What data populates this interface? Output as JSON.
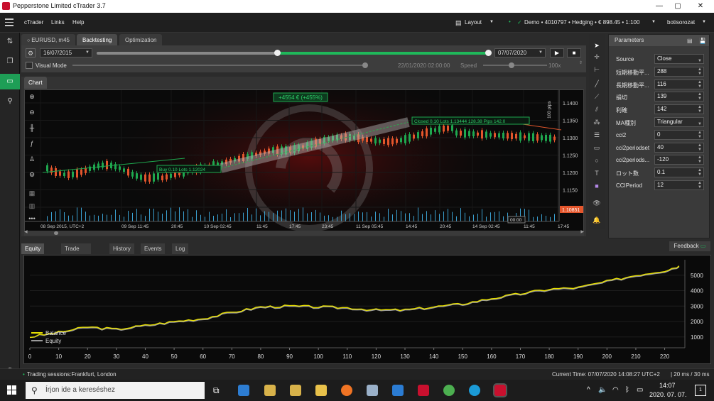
{
  "window": {
    "title": "Pepperstone Limited cTrader 3.7",
    "minimize": "—",
    "maximize": "▢",
    "close": "✕"
  },
  "menu": {
    "items": [
      "cTrader",
      "Links",
      "Help"
    ],
    "layout_label": "Layout",
    "account": "Demo • 4010797 • Hedging • € 898.45 • 1:100",
    "user": "botisorozat"
  },
  "tabs": {
    "symbol_tab": "EURUSD, m45",
    "backtesting": "Backtesting",
    "optimization": "Optimization"
  },
  "backtest": {
    "start_date": "16/07/2015",
    "end_date": "07/07/2020",
    "visual_mode": "Visual Mode",
    "progress_timestamp": "22/01/2020 02:00:00",
    "speed_label": "Speed",
    "speed_value": "100x",
    "range_start_fraction": 0.46,
    "progress_fraction": 1.0
  },
  "chart": {
    "tab_label": "Chart",
    "profit_badge": "+4554 € (+455%)",
    "buy_label": "Buy  0.10 Lots  1.12024",
    "closed_label": "Closed  0.10 Lots  1.13444  128.38  Pips 142.0",
    "pips_label": "100 pips",
    "current_price": "1.10851",
    "price_ticks": [
      "1.1400",
      "1.1350",
      "1.1300",
      "1.1250",
      "1.1200",
      "1.1150",
      "1.1100"
    ],
    "time_ticks": [
      "08 Sep 2015, UTC+2",
      "09 Sep 11:45",
      "20:45",
      "10 Sep 02:45",
      "11:45",
      "17:45",
      "23:45",
      "11 Sep 05:45",
      "14:45",
      "20:45",
      "14 Sep 02:45",
      "11:45",
      "17:45"
    ],
    "hover_time": "00:00",
    "colors": {
      "bull": "#1fa84f",
      "bear": "#e4562c",
      "volume": "#3aa0d0"
    }
  },
  "params": {
    "title": "Parameters",
    "rows": [
      {
        "label": "Source",
        "value": "Close",
        "kind": "select"
      },
      {
        "label": "短期移動平...",
        "value": "288",
        "kind": "spin"
      },
      {
        "label": "長期移動平...",
        "value": "116",
        "kind": "spin"
      },
      {
        "label": "損切",
        "value": "139",
        "kind": "spin"
      },
      {
        "label": "利確",
        "value": "142",
        "kind": "spin"
      },
      {
        "label": "MA種別",
        "value": "Triangular",
        "kind": "select"
      },
      {
        "label": "cci2",
        "value": "0",
        "kind": "spin"
      },
      {
        "label": "cci2periodset",
        "value": "40",
        "kind": "spin"
      },
      {
        "label": "cci2periods...",
        "value": "-120",
        "kind": "spin"
      },
      {
        "label": "ロット数",
        "value": "0.1",
        "kind": "spin"
      },
      {
        "label": "CCIPeriod",
        "value": "12",
        "kind": "spin"
      }
    ]
  },
  "bottom_tabs": [
    "Equity Chart",
    "Trade Statistics",
    "History",
    "Events",
    "Log"
  ],
  "feedback": "Feedback",
  "chart_data": {
    "type": "line",
    "series": [
      {
        "name": "Balance",
        "color": "#e8e000"
      },
      {
        "name": "Equity",
        "color": "#9a9a9a"
      }
    ],
    "x": [
      0,
      10,
      20,
      30,
      40,
      50,
      60,
      70,
      80,
      90,
      100,
      110,
      120,
      130,
      140,
      150,
      160,
      170,
      180,
      190,
      200,
      210,
      220,
      225
    ],
    "balance": [
      1000,
      1300,
      1650,
      1500,
      1750,
      2000,
      2200,
      2600,
      2950,
      3000,
      2950,
      2900,
      2750,
      2750,
      2950,
      3150,
      3500,
      3800,
      4100,
      4200,
      4600,
      5000,
      5300,
      5600
    ],
    "equity": [
      1000,
      1250,
      1600,
      1450,
      1700,
      1950,
      2150,
      2550,
      2900,
      2950,
      2900,
      2850,
      2700,
      2700,
      2900,
      3100,
      3450,
      3750,
      4050,
      4150,
      4550,
      4950,
      5250,
      5550
    ],
    "xticks": [
      "0",
      "10",
      "20",
      "30",
      "40",
      "50",
      "60",
      "70",
      "80",
      "90",
      "100",
      "110",
      "120",
      "130",
      "140",
      "150",
      "160",
      "170",
      "180",
      "190",
      "200",
      "210",
      "220"
    ],
    "yticks": [
      "1000",
      "2000",
      "3000",
      "4000",
      "5000"
    ],
    "xlim": [
      0,
      227
    ],
    "ylim": [
      300,
      6000
    ],
    "legend": "bottom-left",
    "grid": true
  },
  "status": {
    "sessions": "Trading sessions:Frankfurt, London",
    "current_time": "Current Time:  07/07/2020 14:08:27   UTC+2",
    "latency": "| 20 ms / 30 ms"
  },
  "taskbar": {
    "search_placeholder": "Írjon ide a kereséshez",
    "time": "14:07",
    "date": "2020. 07. 07.",
    "notif_count": "1"
  }
}
